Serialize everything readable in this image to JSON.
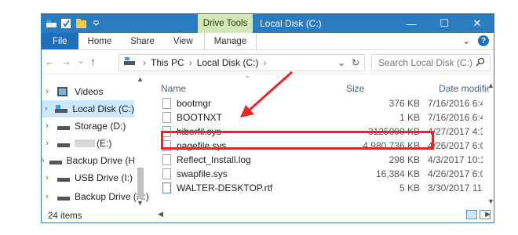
{
  "window": {
    "title": "Local Disk (C:)",
    "contextual_tab": "Drive Tools",
    "controls": [
      "—",
      "☐",
      "✕"
    ]
  },
  "ribbon": {
    "tabs": [
      "File",
      "Home",
      "Share",
      "View",
      "Manage"
    ],
    "expand_glyph": "⌄",
    "help_glyph": "?"
  },
  "address": {
    "segments": [
      "This PC",
      "Local Disk (C:)"
    ],
    "dropdown_glyph": "⌄",
    "refresh_glyph": "↻"
  },
  "search": {
    "placeholder": "Search Local Disk (C:)",
    "icon": "search-icon"
  },
  "navpane": {
    "items": [
      {
        "label": "Videos",
        "icon": "videos-folder-icon",
        "selected": false
      },
      {
        "label": "Local Disk (C:)",
        "icon": "drive-icon",
        "selected": true
      },
      {
        "label": "Storage (D:)",
        "icon": "drive-icon",
        "selected": false
      },
      {
        "label": "(E:)",
        "icon": "drive-icon",
        "selected": false
      },
      {
        "label": "Backup Drive (H",
        "icon": "drive-icon",
        "selected": false
      },
      {
        "label": "USB Drive (I:)",
        "icon": "drive-icon",
        "selected": false
      },
      {
        "label": "Backup Drive (H:)",
        "icon": "drive-icon",
        "selected": false
      }
    ]
  },
  "columns": {
    "name": "Name",
    "size": "Size",
    "date": "Date modifiec"
  },
  "files": [
    {
      "name": "bootmgr",
      "size": "376 KB",
      "date": "7/16/2016 6:4"
    },
    {
      "name": "BOOTNXT",
      "size": "1 KB",
      "date": "7/16/2016 6:4"
    },
    {
      "name": "hiberfil.sys",
      "size": "3125000 KB",
      "date": "4/27/2017 4:3"
    },
    {
      "name": "pagefile.sys",
      "size": "4,980,736 KB",
      "date": "4/26/2017 6:0"
    },
    {
      "name": "Reflect_Install.log",
      "size": "298 KB",
      "date": "4/3/2017 10:1"
    },
    {
      "name": "swapfile.sys",
      "size": "16,384 KB",
      "date": "4/26/2017 6:0"
    },
    {
      "name": "WALTER-DESKTOP.rtf",
      "size": "5 KB",
      "date": "3/30/2017 11:"
    }
  ],
  "status": {
    "item_count": "24 items"
  },
  "colors": {
    "titlebar": "#2b7bbf",
    "annotation": "#e5262b",
    "contextual_tab": "#d2e8b4"
  }
}
